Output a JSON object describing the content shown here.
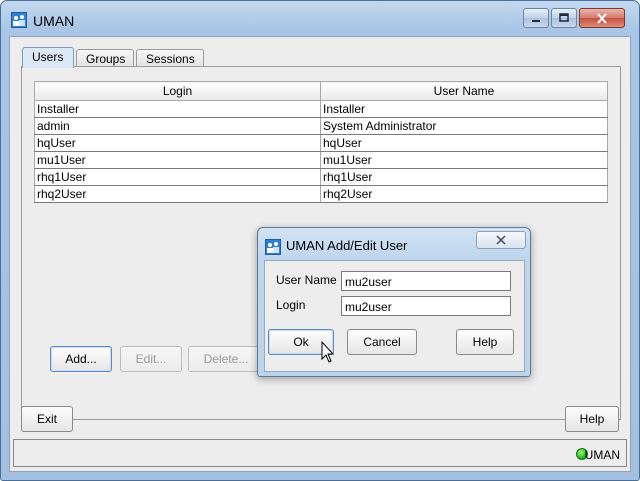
{
  "window": {
    "title": "UMAN",
    "controls": [
      "minimize",
      "maximize",
      "close"
    ]
  },
  "tabs": [
    {
      "label": "Users",
      "active": true
    },
    {
      "label": "Groups",
      "active": false
    },
    {
      "label": "Sessions",
      "active": false
    }
  ],
  "users_table": {
    "columns": [
      "Login",
      "User Name"
    ],
    "rows": [
      {
        "login": "Installer",
        "user_name": "Installer"
      },
      {
        "login": "admin",
        "user_name": "System Administrator"
      },
      {
        "login": "hqUser",
        "user_name": "hqUser"
      },
      {
        "login": "mu1User",
        "user_name": "mu1User"
      },
      {
        "login": "rhq1User",
        "user_name": "rhq1User"
      },
      {
        "login": "rhq2User",
        "user_name": "rhq2User"
      }
    ]
  },
  "panel_buttons": {
    "add": "Add...",
    "edit": "Edit...",
    "delete": "Delete..."
  },
  "footer": {
    "exit": "Exit",
    "help": "Help"
  },
  "status": {
    "text": "UMAN",
    "indicator_color": "#1aa51a"
  },
  "dialog": {
    "title": "UMAN Add/Edit User",
    "user_name_label": "User Name",
    "user_name_value": "mu2user",
    "login_label": "Login",
    "login_value": "mu2user",
    "ok": "Ok",
    "cancel": "Cancel",
    "help": "Help"
  },
  "colors": {
    "title_bar": "#a9c6e6",
    "client_bg": "#ededed",
    "focus_border": "#5b8bc4"
  }
}
